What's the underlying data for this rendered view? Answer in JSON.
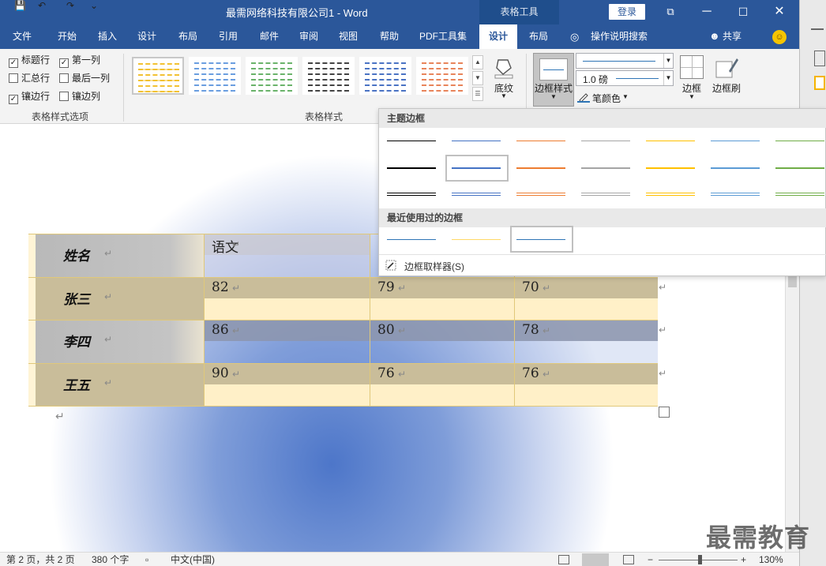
{
  "window": {
    "title": "最需网络科技有限公司1  -  Word",
    "context_tab": "表格工具",
    "login_label": "登录",
    "buttons": {
      "restore": "⧉",
      "minimize": "─",
      "maximize": "☐",
      "close": "✕"
    },
    "quick_access": {
      "save": "💾",
      "undo": "↶",
      "redo": "↷",
      "customize": "⌄"
    }
  },
  "tabs": [
    {
      "label": "文件"
    },
    {
      "label": "开始"
    },
    {
      "label": "插入"
    },
    {
      "label": "设计"
    },
    {
      "label": "布局"
    },
    {
      "label": "引用"
    },
    {
      "label": "邮件"
    },
    {
      "label": "审阅"
    },
    {
      "label": "视图"
    },
    {
      "label": "帮助"
    },
    {
      "label": "PDF工具集"
    },
    {
      "label": "设计",
      "active": true
    },
    {
      "label": "布局"
    }
  ],
  "tellme": "操作说明搜索",
  "share": "共享",
  "ribbon": {
    "style_options": {
      "group_label": "表格样式选项",
      "checks": [
        {
          "label": "标题行",
          "checked": true
        },
        {
          "label": "第一列",
          "checked": true
        },
        {
          "label": "汇总行",
          "checked": false
        },
        {
          "label": "最后一列",
          "checked": false
        },
        {
          "label": "镶边行",
          "checked": true
        },
        {
          "label": "镶边列",
          "checked": false
        }
      ]
    },
    "table_styles": {
      "group_label": "表格样式",
      "swatch_colors": [
        "#f2c232",
        "#6a9ee0",
        "#6ab36a",
        "#444444",
        "#4a73c4",
        "#e8845a"
      ]
    },
    "shading": "底纹",
    "border_styles": "边框样式",
    "pen_weight": "1.0 磅",
    "pen_color": "笔颜色",
    "borders": "边框",
    "border_painter": "边框刷"
  },
  "dropdown": {
    "theme_header": "主题边框",
    "recent_header": "最近使用过的边框",
    "sampler": "边框取样器(S)",
    "theme_colors": [
      "#000000",
      "#4472c4",
      "#ed7d31",
      "#a5a5a5",
      "#ffc000",
      "#5b9bd5",
      "#70ad47"
    ],
    "recent_colors": [
      "#2e75b6",
      "#ffd966",
      "#2e75b6"
    ]
  },
  "table": {
    "rows": [
      {
        "name": "姓名",
        "cells": [
          "语文"
        ]
      },
      {
        "name": "张三",
        "cells": [
          "82",
          "79",
          "70"
        ]
      },
      {
        "name": "李四",
        "cells": [
          "86",
          "80",
          "78"
        ]
      },
      {
        "name": "王五",
        "cells": [
          "90",
          "76",
          "76"
        ]
      }
    ],
    "mark": "↵"
  },
  "status": {
    "page": "第 2 页，共 2 页",
    "words": "380 个字",
    "lang": "中文(中国)",
    "zoom": "130%",
    "zoom_minus": "−",
    "zoom_plus": "+"
  },
  "watermark": "最需教育"
}
